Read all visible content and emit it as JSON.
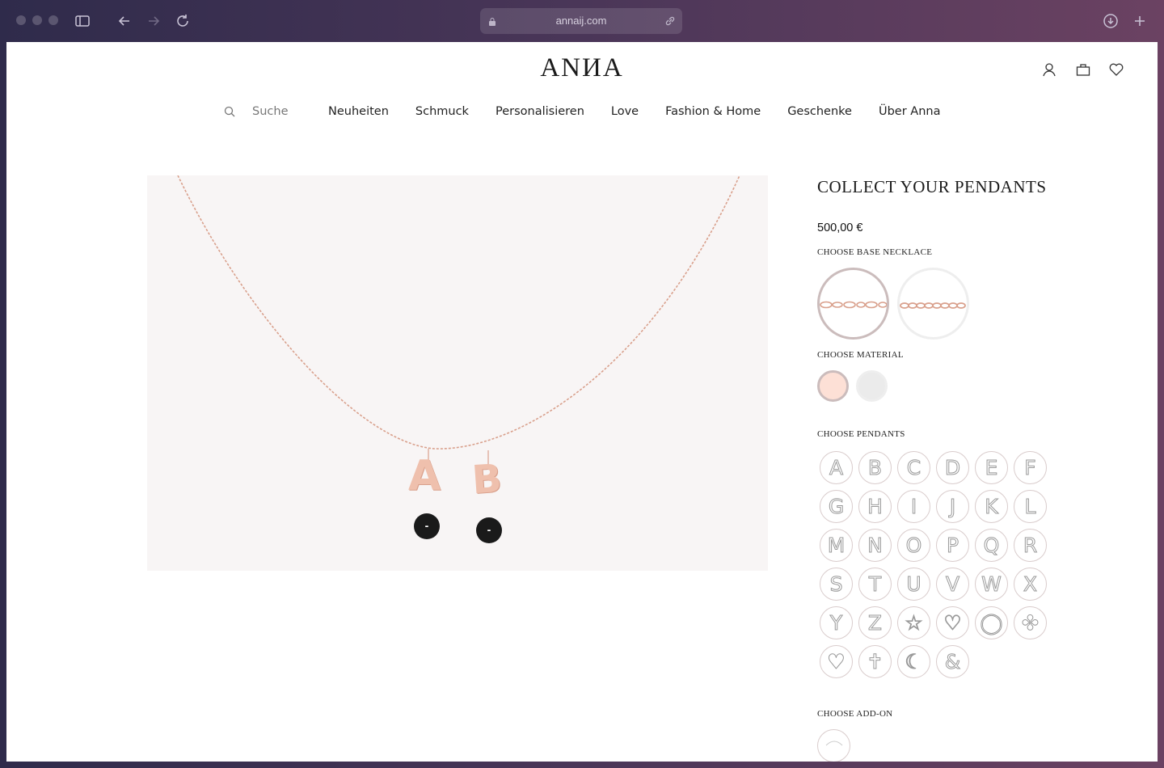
{
  "browser": {
    "url": "annaij.com"
  },
  "header": {
    "logo": "ANИA"
  },
  "nav": {
    "search": "Suche",
    "items": [
      "Neuheiten",
      "Schmuck",
      "Personalisieren",
      "Love",
      "Fashion & Home",
      "Geschenke",
      "Über Anna"
    ]
  },
  "hero": {
    "pendants": [
      "A",
      "B"
    ],
    "remove_label": "-"
  },
  "product": {
    "title": "COLLECT YOUR PENDANTS",
    "price": "500,00 €",
    "base_label": "CHOOSE BASE NECKLACE",
    "material_label": "CHOOSE MATERIAL",
    "materials": [
      {
        "name": "rose-gold",
        "color": "#fde0d6",
        "selected": true
      },
      {
        "name": "silver",
        "color": "#ebebeb",
        "selected": false
      }
    ],
    "pendants_label": "CHOOSE PENDANTS",
    "pendants": [
      "A",
      "B",
      "C",
      "D",
      "E",
      "F",
      "G",
      "H",
      "I",
      "J",
      "K",
      "L",
      "M",
      "N",
      "O",
      "P",
      "Q",
      "R",
      "S",
      "T",
      "U",
      "V",
      "W",
      "X",
      "Y",
      "Z",
      "☆",
      "♡",
      "◯",
      "✤",
      "♥",
      "✝",
      "☾",
      "&"
    ],
    "addon_label": "CHOOSE ADD-ON"
  },
  "colors": {
    "rose_gold": "#e9b8a4",
    "chain": "#d9a08c"
  }
}
